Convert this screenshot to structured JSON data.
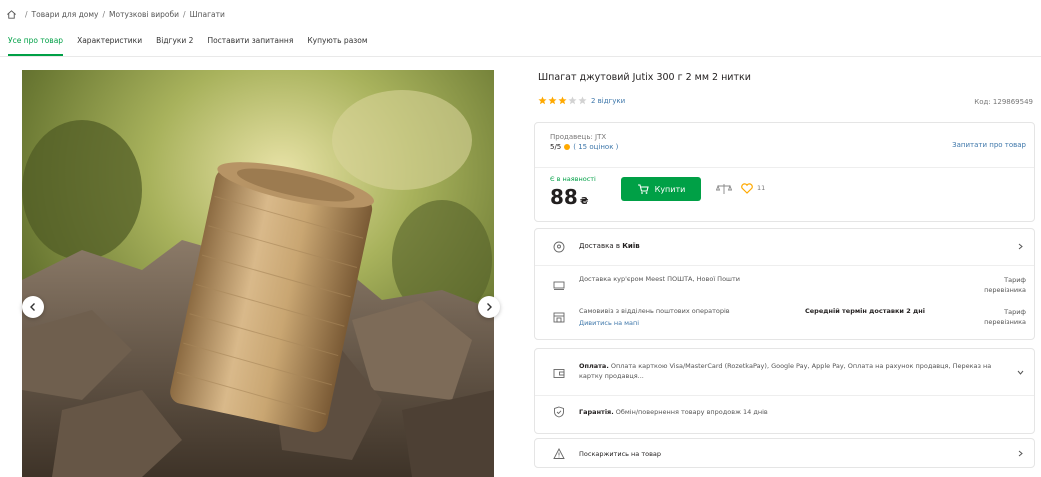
{
  "breadcrumb": {
    "items": [
      "Товари для дому",
      "Мотузкові вироби",
      "Шпагати"
    ],
    "separator": "/"
  },
  "tabs": [
    {
      "label": "Усе про товар",
      "active": true
    },
    {
      "label": "Характеристики",
      "active": false
    },
    {
      "label": "Відгуки 2",
      "active": false
    },
    {
      "label": "Поставити запитання",
      "active": false
    },
    {
      "label": "Купують разом",
      "active": false
    }
  ],
  "product": {
    "title": "Шпагат джутовий Jutix 300 г 2 мм 2 нитки",
    "rating_stars": 3,
    "reviews_label": "2 відгуки",
    "code": "Код: 129869549"
  },
  "seller": {
    "label": "Продавець: JTX",
    "score": "5/5",
    "ratings": "( 15 оцінок )",
    "ask_link": "Запитати про товар"
  },
  "purchase": {
    "stock": "Є в наявності",
    "price": "88",
    "currency": "₴",
    "buy_label": "Купити",
    "wishlist_count": "11"
  },
  "delivery": {
    "city_prefix": "Доставка в",
    "city": "Київ",
    "courier": "Доставка кур'єром Meest ПОШТА, Нової Пошти",
    "courier_tariff": "Тариф перевізника",
    "pickup": "Самовивіз з відділень поштових операторів",
    "pickup_link": "Дивитись на мапі",
    "pickup_term": "Середній термін доставки 2 дні",
    "pickup_tariff": "Тариф перевізника"
  },
  "payment": {
    "title": "Оплата.",
    "text": "Оплата карткою Visa/MasterCard (RozetkaPay), Google Pay, Apple Pay, Оплата на рахунок продавця, Переказ на картку продавця..."
  },
  "warranty": {
    "title": "Гарантія.",
    "text": "Обмін/повернення товару впродовж 14 днів"
  },
  "complaint": {
    "label": "Поскаржитись на товар"
  },
  "colors": {
    "accent": "#00a046",
    "link": "#3e77aa",
    "star": "#ffa900"
  }
}
